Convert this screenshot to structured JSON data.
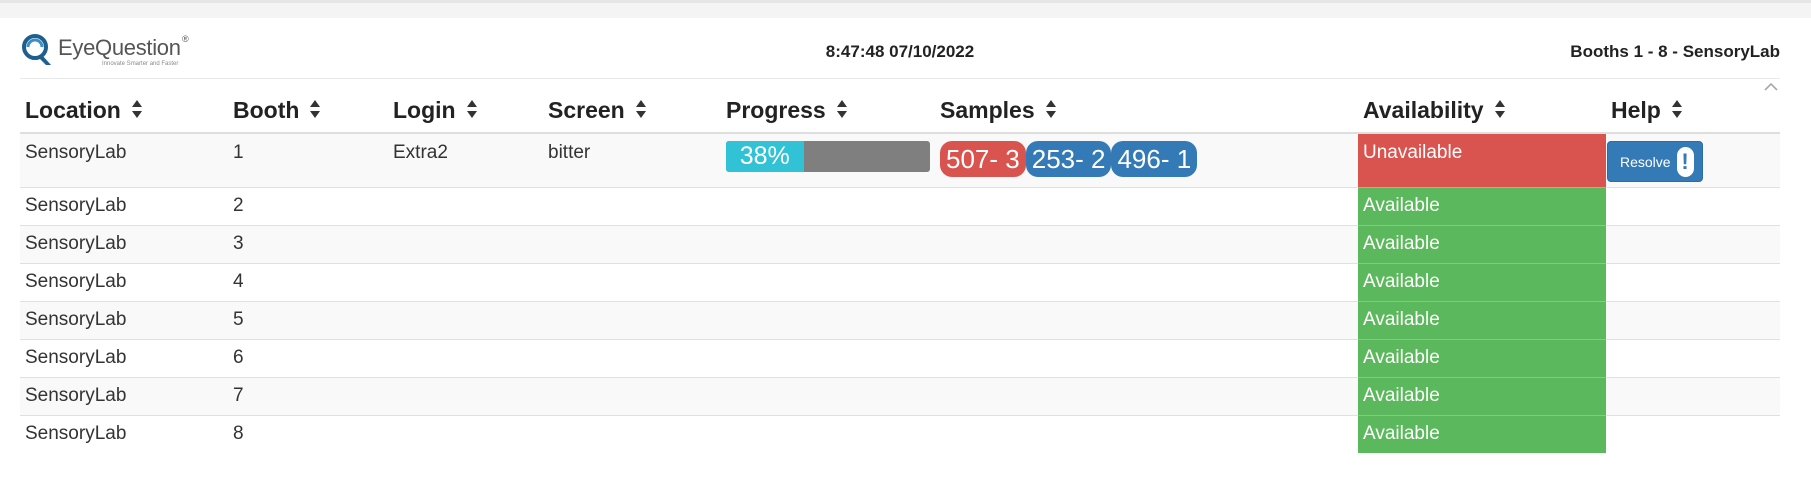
{
  "header": {
    "logo_name": "EyeQuestion",
    "logo_tagline": "Innovate Smarter and Faster",
    "logo_reg": "®",
    "clock": "8:47:48 07/10/2022",
    "booths_title": "Booths 1 - 8 - SensoryLab"
  },
  "columns": [
    "Location",
    "Booth",
    "Login",
    "Screen",
    "Progress",
    "Samples",
    "Availability",
    "Help"
  ],
  "rows": [
    {
      "location": "SensoryLab",
      "booth": "1",
      "login": "Extra2",
      "screen": "bitter",
      "progress_label": "38%",
      "progress": 0.38,
      "samples": [
        {
          "label": "507- 3",
          "color": "#d9534f"
        },
        {
          "label": "253- 2",
          "color": "#337ab7"
        },
        {
          "label": "496- 1",
          "color": "#337ab7"
        }
      ],
      "availability": "Unavailable",
      "help_label": "Resolve",
      "help_icon": "exclamation-icon"
    },
    {
      "location": "SensoryLab",
      "booth": "2",
      "availability": "Available"
    },
    {
      "location": "SensoryLab",
      "booth": "3",
      "availability": "Available"
    },
    {
      "location": "SensoryLab",
      "booth": "4",
      "availability": "Available"
    },
    {
      "location": "SensoryLab",
      "booth": "5",
      "availability": "Available"
    },
    {
      "location": "SensoryLab",
      "booth": "6",
      "availability": "Available"
    },
    {
      "location": "SensoryLab",
      "booth": "7",
      "availability": "Available"
    },
    {
      "location": "SensoryLab",
      "booth": "8",
      "availability": "Available"
    }
  ],
  "colors": {
    "available": "#5cb85c",
    "unavailable": "#d9534f",
    "primary": "#337ab7",
    "progress": "#31c3d5"
  }
}
